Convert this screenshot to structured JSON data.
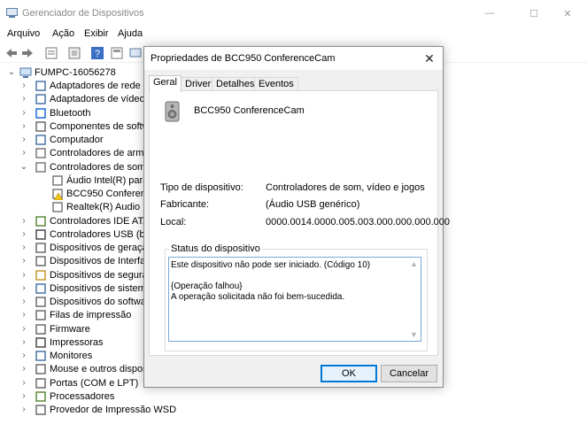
{
  "window": {
    "title": "Gerenciador de Dispositivos",
    "minimize_glyph": "—",
    "maximize_glyph": "☐",
    "close_glyph": "✕"
  },
  "menu": {
    "items": [
      "Arquivo",
      "Ação",
      "Exibir",
      "Ajuda"
    ]
  },
  "tree": {
    "root": "FUMPC-16056278",
    "items": [
      {
        "label": "Adaptadores de rede",
        "icon": "network-adapter-icon"
      },
      {
        "label": "Adaptadores de vídeo",
        "icon": "display-adapter-icon"
      },
      {
        "label": "Bluetooth",
        "icon": "bluetooth-icon"
      },
      {
        "label": "Componentes de softwa",
        "icon": "software-component-icon"
      },
      {
        "label": "Computador",
        "icon": "computer-icon"
      },
      {
        "label": "Controladores de armaz",
        "icon": "storage-controller-icon"
      },
      {
        "label": "Controladores de som, v",
        "icon": "speaker-icon"
      },
      {
        "label": "Áudio Intel(R) para t",
        "icon": "speaker-icon"
      },
      {
        "label": "BCC950 Conference",
        "icon": "speaker-warning-icon"
      },
      {
        "label": "Realtek(R) Audio",
        "icon": "speaker-icon"
      },
      {
        "label": "Controladores IDE ATA/",
        "icon": "ide-controller-icon"
      },
      {
        "label": "Controladores USB (bar",
        "icon": "usb-icon"
      },
      {
        "label": "Dispositivos de geração",
        "icon": "imaging-device-icon"
      },
      {
        "label": "Dispositivos de Interface",
        "icon": "hid-icon"
      },
      {
        "label": "Dispositivos de seguran",
        "icon": "security-device-icon"
      },
      {
        "label": "Dispositivos de sistema",
        "icon": "system-device-icon"
      },
      {
        "label": "Dispositivos do software",
        "icon": "software-device-icon"
      },
      {
        "label": "Filas de impressão",
        "icon": "print-queue-icon"
      },
      {
        "label": "Firmware",
        "icon": "firmware-icon"
      },
      {
        "label": "Impressoras",
        "icon": "printer-icon"
      },
      {
        "label": "Monitores",
        "icon": "monitor-icon"
      },
      {
        "label": "Mouse e outros disposit",
        "icon": "mouse-icon"
      },
      {
        "label": "Portas (COM e LPT)",
        "icon": "port-icon"
      },
      {
        "label": "Processadores",
        "icon": "processor-icon"
      },
      {
        "label": "Provedor de Impressão WSD",
        "icon": "wsd-print-icon"
      }
    ]
  },
  "dialog": {
    "title": "Propriedades de BCC950 ConferenceCam",
    "close_glyph": "✕",
    "tabs": [
      "Geral",
      "Driver",
      "Detalhes",
      "Eventos"
    ],
    "device_name": "BCC950 ConferenceCam",
    "properties": {
      "type_label": "Tipo de dispositivo:",
      "type_value": "Controladores de som, vídeo e jogos",
      "manufacturer_label": "Fabricante:",
      "manufacturer_value": "(Áudio USB genérico)",
      "location_label": "Local:",
      "location_value": "0000.0014.0000.005.003.000.000.000.000"
    },
    "status_label": "Status do dispositivo",
    "status_text": "Este dispositivo não pode ser iniciado. (Código 10)\n\n{Operação falhou}\nA operação solicitada não foi bem-sucedida.",
    "ok_label": "OK",
    "cancel_label": "Cancelar"
  },
  "colors": {
    "accent": "#0078d7",
    "warning": "#f0c419"
  }
}
